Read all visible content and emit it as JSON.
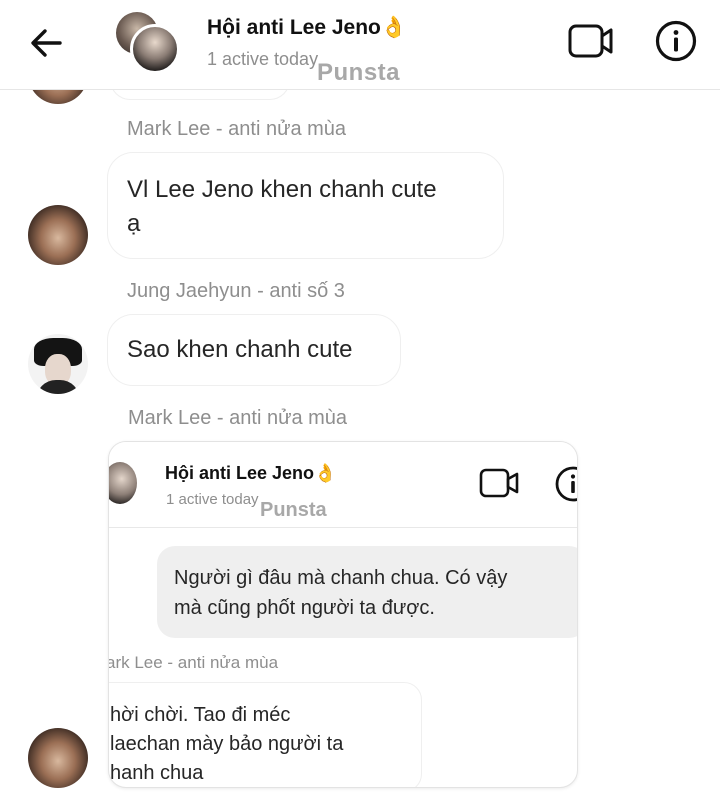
{
  "header": {
    "title": "Hội anti Lee Jeno",
    "emoji": "👌",
    "status": "1 active today",
    "watermark": "Punsta",
    "icons": [
      "back-arrow-icon",
      "video-call-icon",
      "info-icon"
    ]
  },
  "messages": [
    {
      "sender": "Mark Lee - anti nửa mùa",
      "lines": [
        "Vl Lee Jeno khen chanh cute",
        "ạ"
      ]
    },
    {
      "sender": "Jung Jaehyun - anti số 3",
      "lines": [
        "Sao khen chanh cute"
      ]
    },
    {
      "sender": "Mark Lee - anti nửa mùa"
    }
  ],
  "embedded_screenshot": {
    "title": "Hội anti Lee Jeno",
    "emoji": "👌",
    "status": "1 active today",
    "watermark": "Punsta",
    "sent_message": [
      "Người gì đâu mà chanh chua. Có vậy",
      "mà cũng phốt người ta được."
    ],
    "sender": "ark Lee - anti nửa mùa",
    "received_message": [
      "hời chời. Tao đi méc",
      "laechan mày bảo người ta",
      "hanh chua"
    ]
  },
  "colors": {
    "text": "#262626",
    "muted": "#8e8e8e",
    "sent_bubble": "#efefef",
    "border": "#efefef"
  }
}
